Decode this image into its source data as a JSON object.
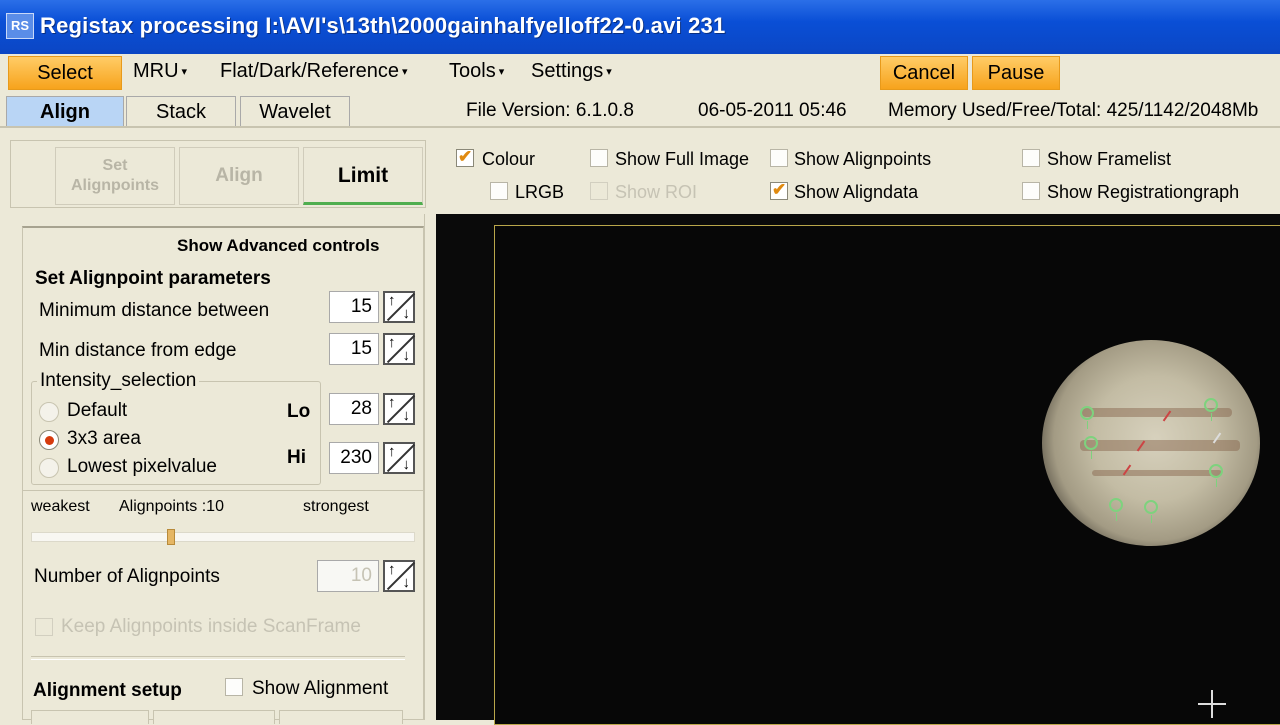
{
  "window": {
    "icon_text": "RS",
    "title": "Registax processing I:\\AVI's\\13th\\2000gainhalfyelloff22-0.avi 231"
  },
  "menubar": {
    "select": "Select",
    "mru": "MRU",
    "flat": "Flat/Dark/Reference",
    "tools": "Tools",
    "settings": "Settings",
    "cancel": "Cancel",
    "pause": "Pause",
    "caret": "▾"
  },
  "tabs": {
    "align": "Align",
    "stack": "Stack",
    "wavelet": "Wavelet"
  },
  "status": {
    "file_version": "File Version: 6.1.0.8",
    "datetime": "06-05-2011 05:46",
    "memory": "Memory Used/Free/Total: 425/1142/2048Mb"
  },
  "subbuttons": {
    "set_alignpoints_1": "Set",
    "set_alignpoints_2": "Alignpoints",
    "align": "Align",
    "limit": "Limit"
  },
  "options": {
    "colour": "Colour",
    "lrgb": "LRGB",
    "show_full_image": "Show Full Image",
    "show_roi": "Show ROI",
    "show_alignpoints": "Show Alignpoints",
    "show_aligndata": "Show Aligndata",
    "show_framelist": "Show Framelist",
    "show_registrationgraph": "Show Registrationgraph"
  },
  "panel": {
    "show_advanced": "Show Advanced controls",
    "section_title": "Set Alignpoint parameters",
    "min_distance_label": "Minimum distance between",
    "min_distance_value": "15",
    "min_edge_label": "Min distance from edge",
    "min_edge_value": "15",
    "intensity_group": "Intensity_selection",
    "radio_default": "Default",
    "radio_3x3": "3x3 area",
    "radio_lowest": "Lowest pixelvalue",
    "lo_label": "Lo",
    "lo_value": "28",
    "hi_label": "Hi",
    "hi_value": "230",
    "weakest": "weakest",
    "alignpoints_count": "Alignpoints :10",
    "strongest": "strongest",
    "slider_fraction": 0.36,
    "num_alignpoints_label": "Number of Alignpoints",
    "num_alignpoints_value": "10",
    "keep_inside": "Keep Alignpoints inside ScanFrame",
    "alignment_setup": "Alignment setup",
    "show_alignment": "Show Alignment"
  },
  "colors": {
    "accent_orange": "#f7a31c",
    "active_tab": "#b9d5f5",
    "check_mark": "#e08a10",
    "alignpoint_green": "#7ed27e"
  }
}
